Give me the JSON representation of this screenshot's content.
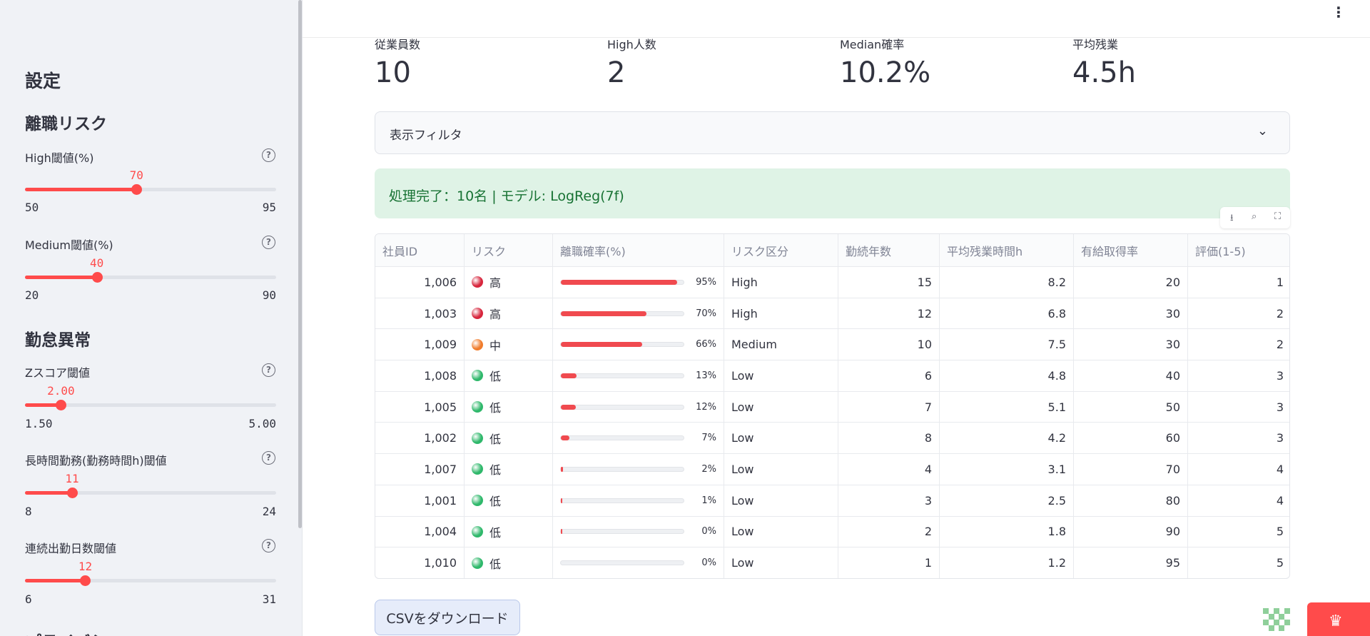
{
  "sidebar": {
    "title": "設定",
    "sections": {
      "risk": "離職リスク",
      "attendance": "勤怠異常",
      "next": "プライバシ"
    },
    "sliders": [
      {
        "label": "High閾値(%)",
        "value": "70",
        "min": "50",
        "max": "95",
        "fraction": 0.444
      },
      {
        "label": "Medium閾値(%)",
        "value": "40",
        "min": "20",
        "max": "90",
        "fraction": 0.286
      },
      {
        "label": "Zスコア閾値",
        "value": "2.00",
        "min": "1.50",
        "max": "5.00",
        "fraction": 0.143
      },
      {
        "label": "長時間勤務(勤務時間h)閾値",
        "value": "11",
        "min": "8",
        "max": "24",
        "fraction": 0.1875
      },
      {
        "label": "連続出勤日数閾値",
        "value": "12",
        "min": "6",
        "max": "31",
        "fraction": 0.24
      }
    ],
    "help_glyph": "?"
  },
  "header": {
    "menu_glyph": "⋮"
  },
  "metrics": [
    {
      "label": "従業員数",
      "value": "10"
    },
    {
      "label": "High人数",
      "value": "2"
    },
    {
      "label": "Median確率",
      "value": "10.2%"
    },
    {
      "label": "平均残業",
      "value": "4.5h"
    }
  ],
  "filter": {
    "title": "表示フィルタ",
    "chevron": "⌄"
  },
  "status": {
    "message": "処理完了：10名 | モデル: LogReg(7f)"
  },
  "toolbar": {
    "download_icon": "⭳",
    "search_icon": "⌕",
    "fullscreen_icon": "⛶"
  },
  "table": {
    "headers": [
      "社員ID",
      "リスク",
      "離職確率(%)",
      "リスク区分",
      "勤続年数",
      "平均残業時間h",
      "有給取得率",
      "評価(1-5)"
    ],
    "rows": [
      {
        "id": "1,006",
        "risk": "高",
        "risk_color": "#d7263d",
        "prob": 95,
        "prob_label": "95%",
        "class": "High",
        "years": "15",
        "overtime": "8.2",
        "leave": "20",
        "rating": "1"
      },
      {
        "id": "1,003",
        "risk": "高",
        "risk_color": "#d7263d",
        "prob": 70,
        "prob_label": "70%",
        "class": "High",
        "years": "12",
        "overtime": "6.8",
        "leave": "30",
        "rating": "2"
      },
      {
        "id": "1,009",
        "risk": "中",
        "risk_color": "#f07c2c",
        "prob": 66,
        "prob_label": "66%",
        "class": "Medium",
        "years": "10",
        "overtime": "7.5",
        "leave": "30",
        "rating": "2"
      },
      {
        "id": "1,008",
        "risk": "低",
        "risk_color": "#2fb86b",
        "prob": 13,
        "prob_label": "13%",
        "class": "Low",
        "years": "6",
        "overtime": "4.8",
        "leave": "40",
        "rating": "3"
      },
      {
        "id": "1,005",
        "risk": "低",
        "risk_color": "#2fb86b",
        "prob": 12,
        "prob_label": "12%",
        "class": "Low",
        "years": "7",
        "overtime": "5.1",
        "leave": "50",
        "rating": "3"
      },
      {
        "id": "1,002",
        "risk": "低",
        "risk_color": "#2fb86b",
        "prob": 7,
        "prob_label": "7%",
        "class": "Low",
        "years": "8",
        "overtime": "4.2",
        "leave": "60",
        "rating": "3"
      },
      {
        "id": "1,007",
        "risk": "低",
        "risk_color": "#2fb86b",
        "prob": 2,
        "prob_label": "2%",
        "class": "Low",
        "years": "4",
        "overtime": "3.1",
        "leave": "70",
        "rating": "4"
      },
      {
        "id": "1,001",
        "risk": "低",
        "risk_color": "#2fb86b",
        "prob": 1,
        "prob_label": "1%",
        "class": "Low",
        "years": "3",
        "overtime": "2.5",
        "leave": "80",
        "rating": "4"
      },
      {
        "id": "1,004",
        "risk": "低",
        "risk_color": "#2fb86b",
        "prob": 0.4,
        "prob_label": "0%",
        "class": "Low",
        "years": "2",
        "overtime": "1.8",
        "leave": "90",
        "rating": "5"
      },
      {
        "id": "1,010",
        "risk": "低",
        "risk_color": "#2fb86b",
        "prob": 0,
        "prob_label": "0%",
        "class": "Low",
        "years": "1",
        "overtime": "1.2",
        "leave": "95",
        "rating": "5"
      }
    ]
  },
  "download": {
    "label": "CSVをダウンロード"
  },
  "badge": {
    "crown_glyph": "♛"
  },
  "colors": {
    "accent": "#ff4b4b",
    "success_bg": "#dff3e6",
    "success_text": "#177233"
  }
}
